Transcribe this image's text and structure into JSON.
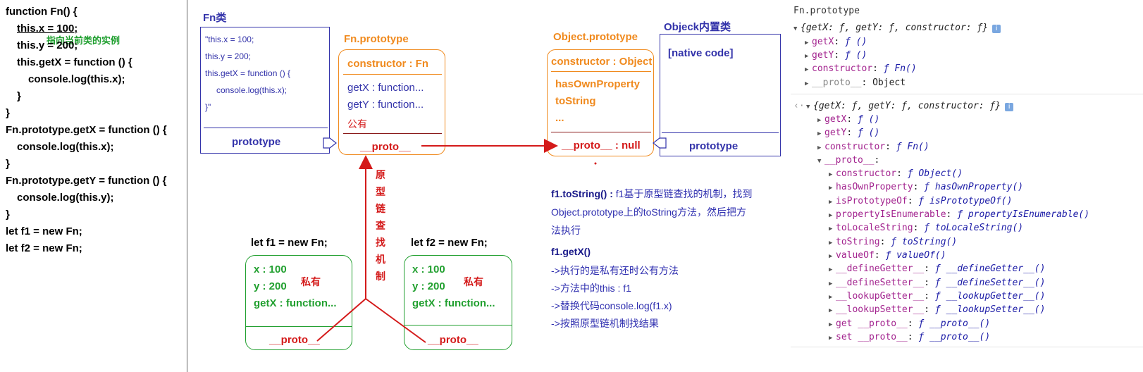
{
  "code": {
    "lines": [
      "function Fn() {",
      "this.x = 100;",
      "this.y = 200;",
      "this.getX = function () {",
      "console.log(this.x);",
      "}",
      "}",
      "Fn.prototype.getX = function () {",
      "console.log(this.x);",
      "}",
      "Fn.prototype.getY = function () {",
      "console.log(this.y);",
      "}",
      "let f1 = new Fn;",
      "let f2 = new Fn;"
    ],
    "note": "指向当前类的实例"
  },
  "diagram": {
    "fn_title": "Fn类",
    "fn_code": [
      "\"this.x = 100;",
      "this.y = 200;",
      "this.getX = function () {",
      "console.log(this.x);",
      "}\""
    ],
    "fn_prototype_label": "prototype",
    "fnproto_title": "Fn.prototype",
    "fnproto_constructor": "constructor : Fn",
    "fnproto_getx": "getX : function...",
    "fnproto_gety": "getY : function...",
    "fnproto_public": "公有",
    "fnproto_proto": "__proto__",
    "objproto_title": "Object.prototype",
    "objproto_constructor": "constructor : Object",
    "objproto_has": "hasOwnProperty",
    "objproto_tostring": "toString",
    "objproto_more": "...",
    "objproto_proto": "__proto__ : null",
    "objclass_title": "Objeck内置类",
    "objclass_native": "[native code]",
    "objclass_prototype": "prototype",
    "chain_label": [
      "原",
      "型",
      "链",
      "查",
      "找",
      "机",
      "制"
    ],
    "f1_title": "let f1 = new Fn;",
    "f2_title": "let f2 = new Fn;",
    "inst_x": "x : 100",
    "inst_y": "y : 200",
    "inst_getx": "getX : function...",
    "inst_private": "私有",
    "inst_proto": "__proto__",
    "tostring_note_bold": "f1.toString() : ",
    "tostring_note_1": "f1基于原型链查找的机制，找到",
    "tostring_note_2": "Object.prototype上的toString方法，然后把方",
    "tostring_note_3": "法执行",
    "getx_title": "f1.getX()",
    "getx_steps": [
      "->执行的是私有还时公有方法",
      "->方法中的this : f1",
      "->替换代码console.log(f1.x)",
      "->按照原型链机制找结果"
    ],
    "colors": {
      "blue": "#3333aa",
      "orange": "#f08a1e",
      "green": "#22a030",
      "red": "#d41a1a"
    }
  },
  "console": {
    "header": "Fn.prototype",
    "obj1_summary": "{getX: ƒ, getY: ƒ, constructor: ƒ}",
    "obj1_props": [
      {
        "key": "getX",
        "val": "ƒ ()"
      },
      {
        "key": "getY",
        "val": "ƒ ()"
      },
      {
        "key": "constructor",
        "val": "ƒ Fn()"
      },
      {
        "key": "__proto__",
        "val": "Object"
      }
    ],
    "return_arrow": "‹·",
    "obj2_summary": "{getX: ƒ, getY: ƒ, constructor: ƒ}",
    "obj2_props": [
      {
        "key": "getX",
        "val": "ƒ ()"
      },
      {
        "key": "getY",
        "val": "ƒ ()"
      },
      {
        "key": "constructor",
        "val": "ƒ Fn()"
      },
      {
        "key": "__proto__",
        "val": ""
      }
    ],
    "proto_props": [
      {
        "key": "constructor",
        "val": "ƒ Object()"
      },
      {
        "key": "hasOwnProperty",
        "val": "ƒ hasOwnProperty()"
      },
      {
        "key": "isPrototypeOf",
        "val": "ƒ isPrototypeOf()"
      },
      {
        "key": "propertyIsEnumerable",
        "val": "ƒ propertyIsEnumerable()"
      },
      {
        "key": "toLocaleString",
        "val": "ƒ toLocaleString()"
      },
      {
        "key": "toString",
        "val": "ƒ toString()"
      },
      {
        "key": "valueOf",
        "val": "ƒ valueOf()"
      },
      {
        "key": "__defineGetter__",
        "val": "ƒ __defineGetter__()"
      },
      {
        "key": "__defineSetter__",
        "val": "ƒ __defineSetter__()"
      },
      {
        "key": "__lookupGetter__",
        "val": "ƒ __lookupGetter__()"
      },
      {
        "key": "__lookupSetter__",
        "val": "ƒ __lookupSetter__()"
      },
      {
        "key": "get __proto__",
        "val": "ƒ __proto__()"
      },
      {
        "key": "set __proto__",
        "val": "ƒ __proto__()"
      }
    ]
  }
}
